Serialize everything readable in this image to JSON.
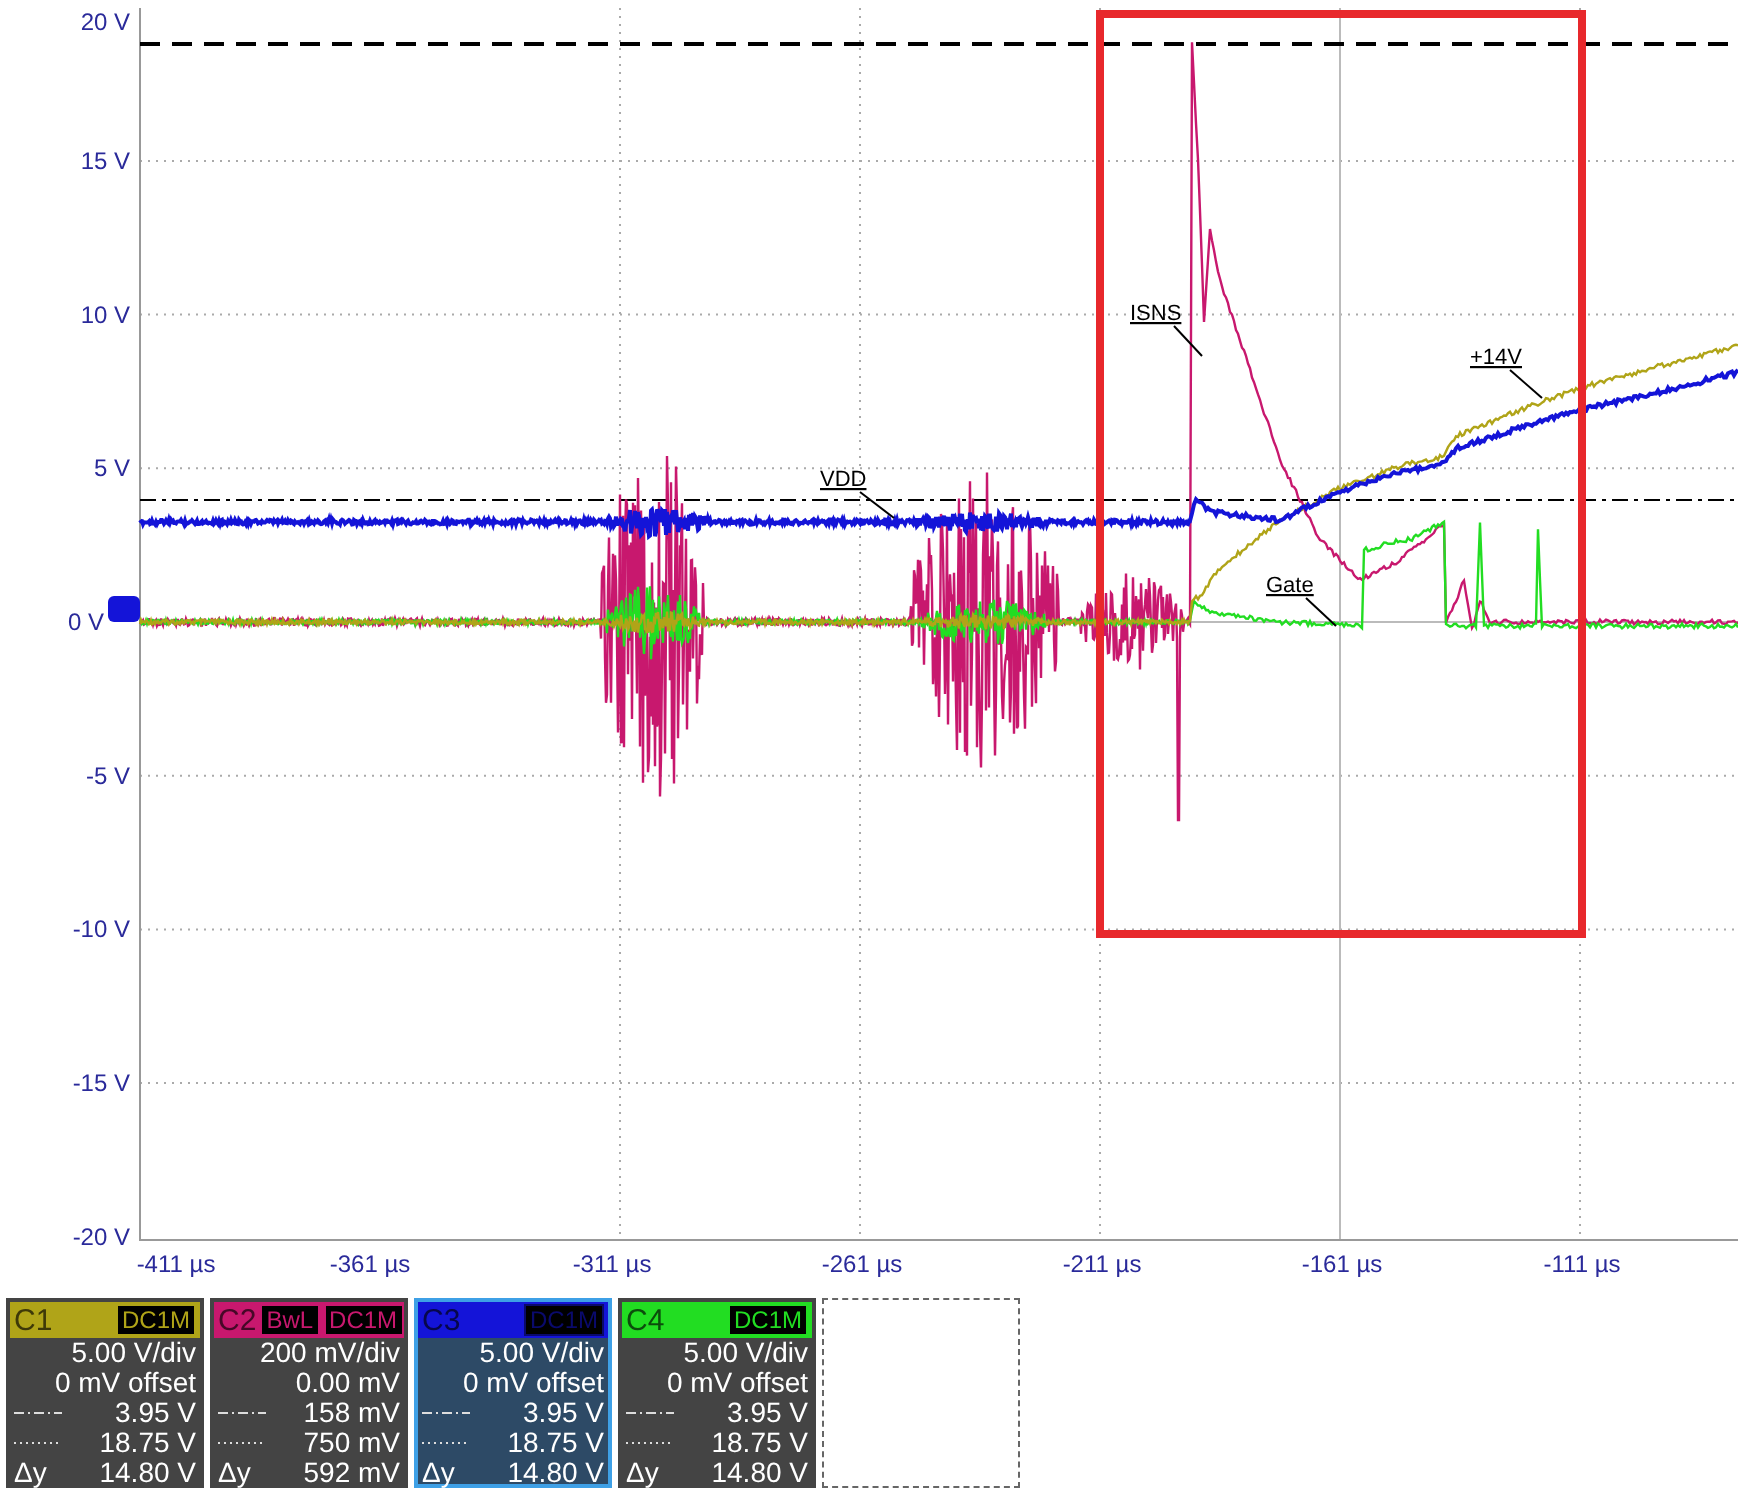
{
  "plot": {
    "y_labels": [
      "20 V",
      "15 V",
      "10 V",
      "5 V",
      "0 V",
      "-5 V",
      "-10 V",
      "-15 V",
      "-20 V"
    ],
    "x_labels": [
      "-411 µs",
      "-361 µs",
      "-311 µs",
      "-261 µs",
      "-211 µs",
      "-161 µs",
      "-111 µs"
    ],
    "annotations": [
      {
        "text": "VDD"
      },
      {
        "text": "ISNS"
      },
      {
        "text": "+14V"
      },
      {
        "text": "Gate"
      }
    ]
  },
  "channels": [
    {
      "name": "C1",
      "color": "#b0a418",
      "selected": false,
      "tags": [
        "DC1M"
      ],
      "rows": [
        {
          "kind": "plain",
          "value": "5.00 V/div"
        },
        {
          "kind": "plain",
          "value": "0 mV offset"
        },
        {
          "kind": "dashdot",
          "value": "3.95 V"
        },
        {
          "kind": "dotted",
          "value": "18.75 V"
        },
        {
          "kind": "delta",
          "label": "Δy",
          "value": "14.80 V"
        }
      ]
    },
    {
      "name": "C2",
      "color": "#c8186e",
      "selected": false,
      "tags": [
        "BwL",
        "DC1M"
      ],
      "rows": [
        {
          "kind": "plain",
          "value": "200 mV/div"
        },
        {
          "kind": "plain",
          "value": "0.00 mV"
        },
        {
          "kind": "dashdot",
          "value": "158 mV"
        },
        {
          "kind": "dotted",
          "value": "750 mV"
        },
        {
          "kind": "delta",
          "label": "Δy",
          "value": "592 mV"
        }
      ]
    },
    {
      "name": "C3",
      "color": "#1414d8",
      "selected": true,
      "tags": [
        "DC1M"
      ],
      "rows": [
        {
          "kind": "plain",
          "value": "5.00 V/div"
        },
        {
          "kind": "plain",
          "value": "0 mV offset"
        },
        {
          "kind": "dashdot",
          "value": "3.95 V"
        },
        {
          "kind": "dotted",
          "value": "18.75 V"
        },
        {
          "kind": "delta",
          "label": "Δy",
          "value": "14.80 V"
        }
      ]
    },
    {
      "name": "C4",
      "color": "#22dd22",
      "selected": false,
      "tags": [
        "DC1M"
      ],
      "rows": [
        {
          "kind": "plain",
          "value": "5.00 V/div"
        },
        {
          "kind": "plain",
          "value": "0 mV offset"
        },
        {
          "kind": "dashdot",
          "value": "3.95 V"
        },
        {
          "kind": "dotted",
          "value": "18.75 V"
        },
        {
          "kind": "delta",
          "label": "Δy",
          "value": "14.80 V"
        }
      ]
    }
  ]
}
